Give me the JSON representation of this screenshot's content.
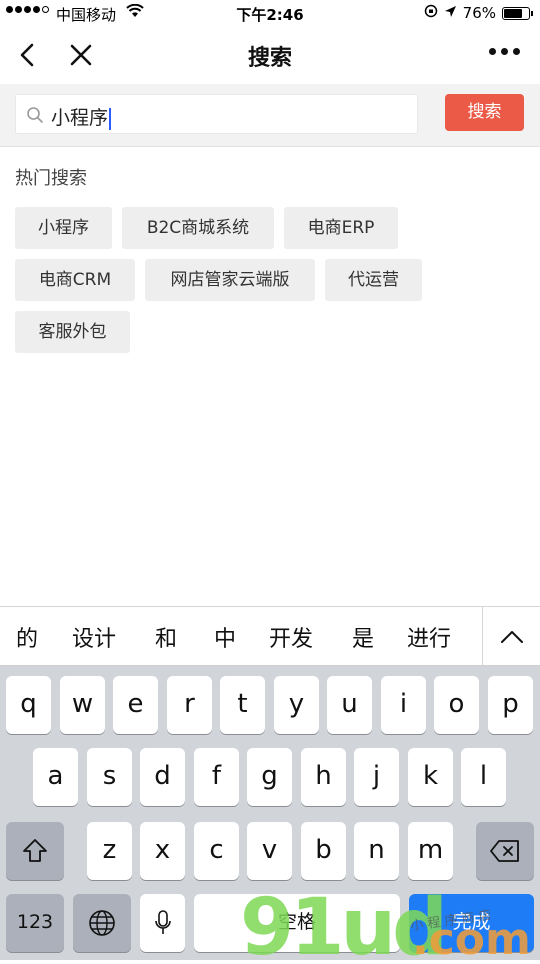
{
  "status_bar": {
    "carrier": "中国移动",
    "time": "下午2:46",
    "battery": "76%"
  },
  "navbar": {
    "title": "搜索"
  },
  "search": {
    "query": "小程序",
    "button_label": "搜索"
  },
  "hot_search": {
    "title": "热门搜索",
    "tags": [
      "小程序",
      "B2C商城系统",
      "电商ERP",
      "电商CRM",
      "网店管家云端版",
      "代运营",
      "客服外包"
    ]
  },
  "keyboard": {
    "suggestions": [
      "的",
      "设计",
      "和",
      "中",
      "开发",
      "是",
      "进行"
    ],
    "row1": [
      "q",
      "w",
      "e",
      "r",
      "t",
      "y",
      "u",
      "i",
      "o",
      "p"
    ],
    "row2": [
      "a",
      "s",
      "d",
      "f",
      "g",
      "h",
      "j",
      "k",
      "l"
    ],
    "row3": [
      "z",
      "x",
      "c",
      "v",
      "b",
      "n",
      "m"
    ],
    "num_label": "123",
    "space_label": "空格",
    "done_label": "完成"
  },
  "watermark": {
    "logo": "91ud.com",
    "tagline": "小程序商店"
  },
  "colors": {
    "accent": "#ea5a47",
    "done_key": "#1e7cf7",
    "keyboard_bg": "#d1d4d9"
  }
}
